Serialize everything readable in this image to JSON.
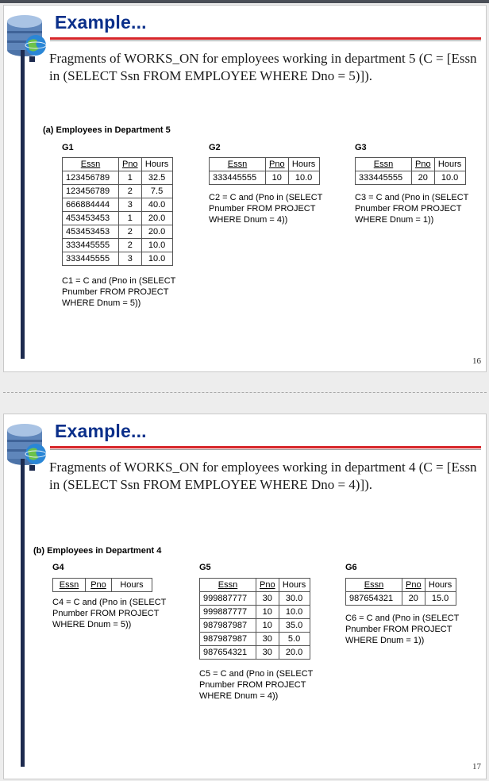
{
  "slides": [
    {
      "title": "Example...",
      "text": "Fragments of WORKS_ON for employees working in department 5 (C = [Essn in (SELECT Ssn FROM EMPLOYEE WHERE Dno = 5)]).",
      "figure_label": "(a)  Employees in Department 5",
      "groups": [
        {
          "name": "G1",
          "headers": [
            "Essn",
            "Pno",
            "Hours"
          ],
          "rows": [
            [
              "123456789",
              "1",
              "32.5"
            ],
            [
              "123456789",
              "2",
              "7.5"
            ],
            [
              "666884444",
              "3",
              "40.0"
            ],
            [
              "453453453",
              "1",
              "20.0"
            ],
            [
              "453453453",
              "2",
              "20.0"
            ],
            [
              "333445555",
              "2",
              "10.0"
            ],
            [
              "333445555",
              "3",
              "10.0"
            ]
          ],
          "condition": "C1 = C and (Pno in (SELECT\nPnumber FROM PROJECT\nWHERE Dnum = 5))"
        },
        {
          "name": "G2",
          "headers": [
            "Essn",
            "Pno",
            "Hours"
          ],
          "rows": [
            [
              "333445555",
              "10",
              "10.0"
            ]
          ],
          "condition": "C2 = C and (Pno in (SELECT\nPnumber FROM PROJECT\nWHERE Dnum = 4))"
        },
        {
          "name": "G3",
          "headers": [
            "Essn",
            "Pno",
            "Hours"
          ],
          "rows": [
            [
              "333445555",
              "20",
              "10.0"
            ]
          ],
          "condition": "C3 = C and (Pno in (SELECT\nPnumber FROM PROJECT\nWHERE Dnum = 1))"
        }
      ],
      "page_number": "16"
    },
    {
      "title": "Example...",
      "text": "Fragments of WORKS_ON for employees working in department 4 (C = [Essn in (SELECT Ssn FROM EMPLOYEE WHERE Dno = 4)]).",
      "figure_label": "(b)  Employees in Department 4",
      "groups": [
        {
          "name": "G4",
          "headers": [
            "Essn",
            "Pno",
            "Hours"
          ],
          "rows": [],
          "condition": "C4 = C and (Pno in (SELECT\nPnumber FROM PROJECT\nWHERE Dnum = 5))"
        },
        {
          "name": "G5",
          "headers": [
            "Essn",
            "Pno",
            "Hours"
          ],
          "rows": [
            [
              "999887777",
              "30",
              "30.0"
            ],
            [
              "999887777",
              "10",
              "10.0"
            ],
            [
              "987987987",
              "10",
              "35.0"
            ],
            [
              "987987987",
              "30",
              "5.0"
            ],
            [
              "987654321",
              "30",
              "20.0"
            ]
          ],
          "condition": "C5 = C and (Pno in (SELECT\nPnumber FROM PROJECT\nWHERE Dnum = 4))"
        },
        {
          "name": "G6",
          "headers": [
            "Essn",
            "Pno",
            "Hours"
          ],
          "rows": [
            [
              "987654321",
              "20",
              "15.0"
            ]
          ],
          "condition": "C6 = C and (Pno in (SELECT\nPnumber FROM PROJECT\nWHERE Dnum = 1))"
        }
      ],
      "page_number": "17"
    }
  ],
  "colors": {
    "title": "#0a2f8a",
    "rule": "#d7262a",
    "bar": "#1d2b4f"
  },
  "icons": [
    "database-globe-icon"
  ]
}
